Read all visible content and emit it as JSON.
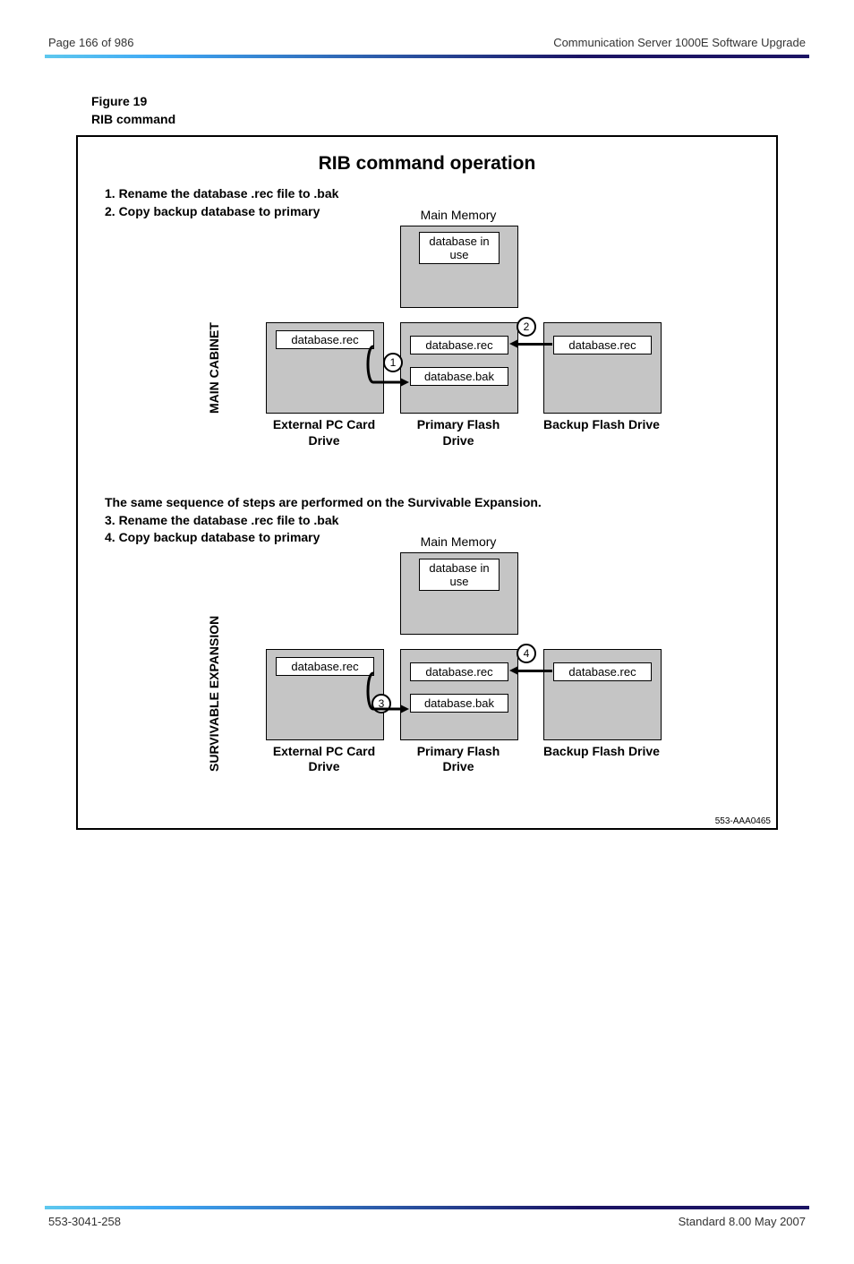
{
  "header": {
    "left": "Page 166 of 986",
    "right": "Communication Server 1000E Software Upgrade"
  },
  "footer": {
    "left": "553-3041-258",
    "right": "Standard 8.00  May 2007"
  },
  "caption_label": "Figure 19",
  "caption_title": "RIB command",
  "diagram": {
    "title": "RIB command operation",
    "steps_a": [
      "1. Rename the database .rec file to .bak",
      "2. Copy backup database to primary"
    ],
    "steps_b_intro": "The same sequence of steps are performed on the Survivable Expansion.",
    "steps_b": [
      "3. Rename the database .rec file to .bak",
      "4. Copy backup database to primary"
    ],
    "section_a_label": "MAIN CABINET",
    "section_b_label": "SURVIVABLE EXPANSION",
    "mem_label": "Main Memory",
    "mem_box": "database in use",
    "ext_box": "database.rec",
    "pri_box_rec": "database.rec",
    "pri_box_bak": "database.bak",
    "bak_box": "database.rec",
    "ext_label": "External PC Card Drive",
    "pri_label": "Primary Flash Drive",
    "bak_label": "Backup Flash Drive",
    "circle_1": "1",
    "circle_2": "2",
    "circle_3": "3",
    "circle_4": "4",
    "drawing_id": "553-AAA0465"
  }
}
